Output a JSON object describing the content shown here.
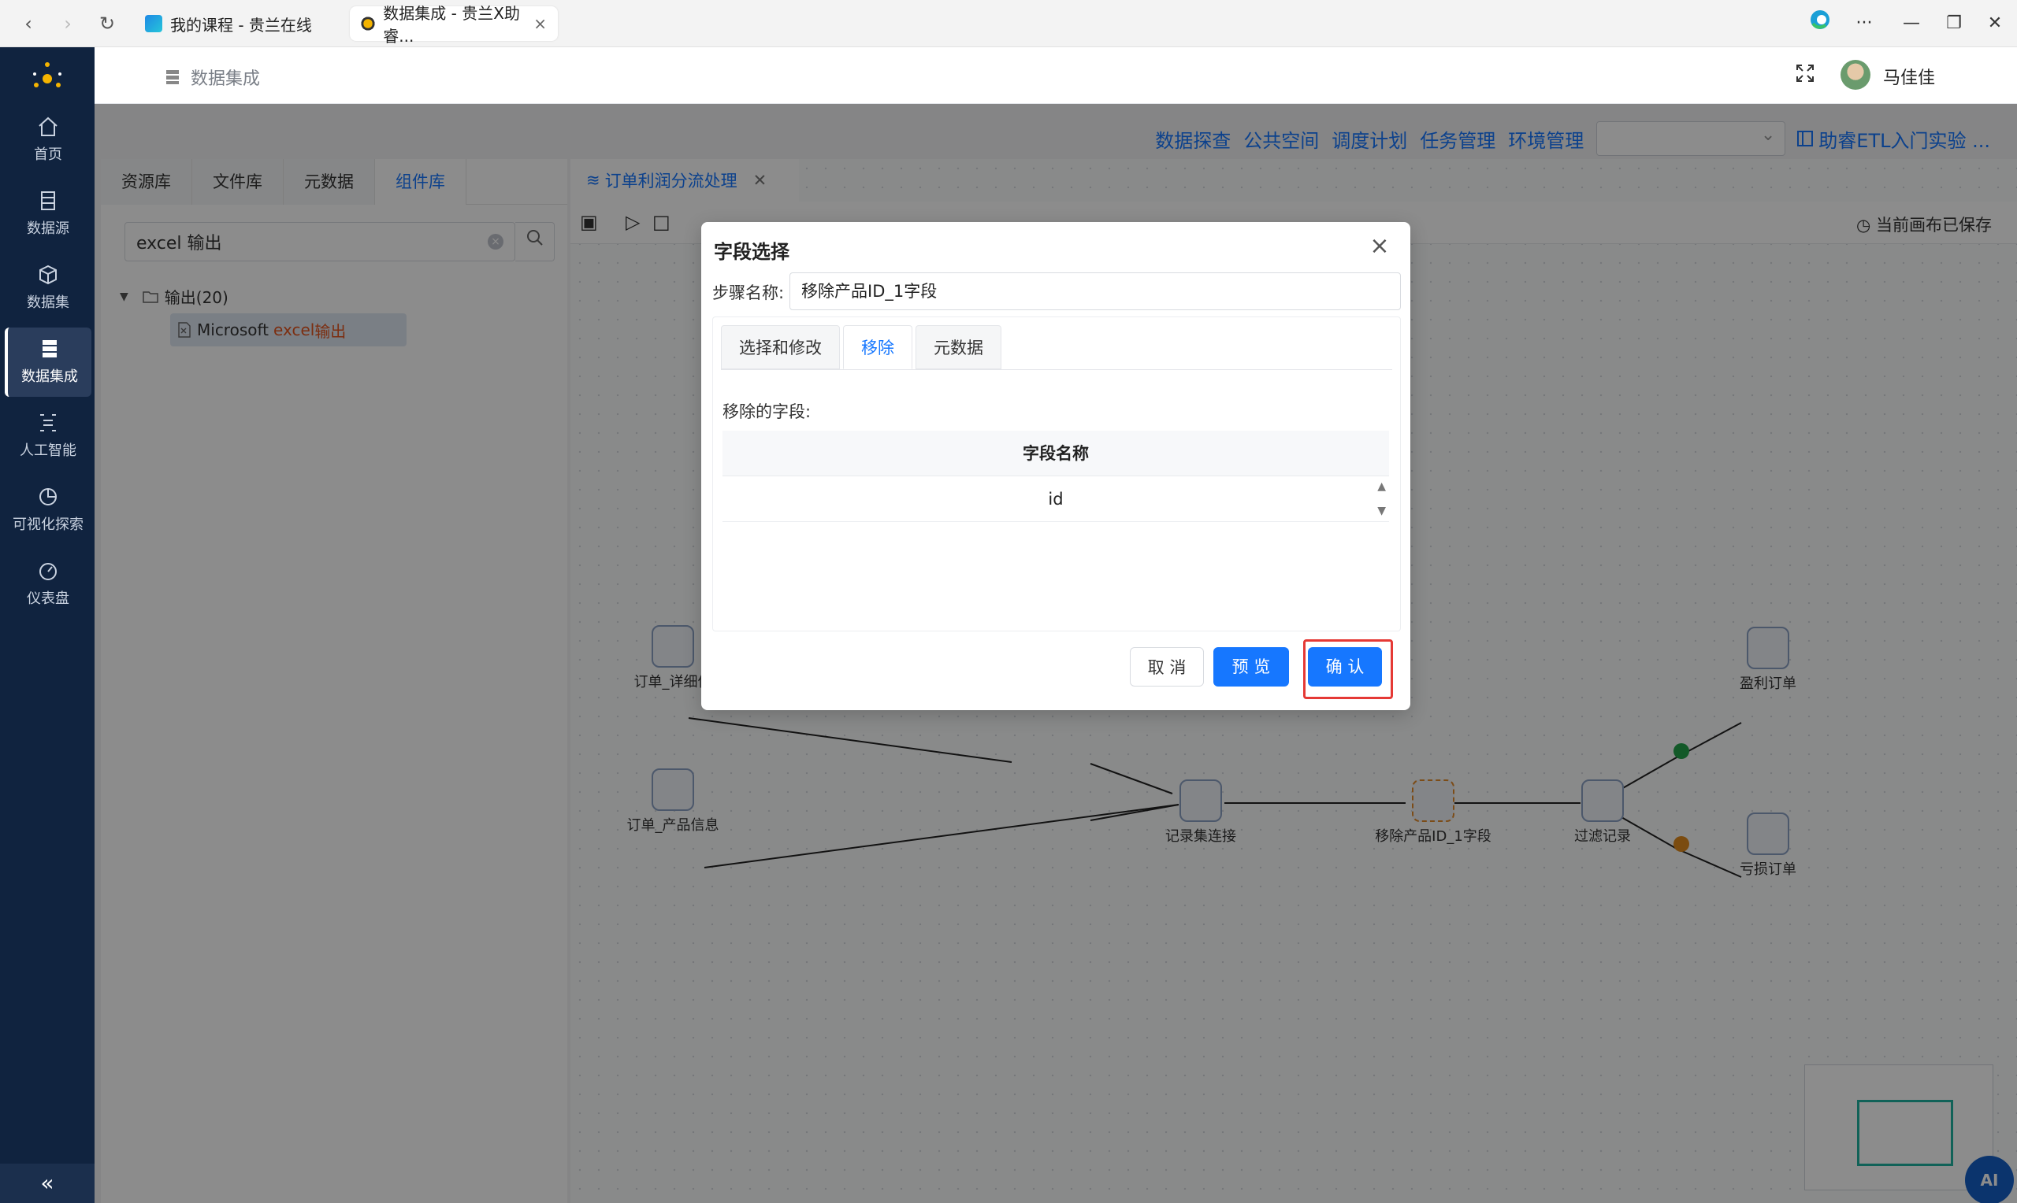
{
  "browser": {
    "tabs": [
      {
        "title": "我的课程 - 贵兰在线"
      },
      {
        "title": "数据集成 - 贵兰X助睿...",
        "close": "×"
      }
    ],
    "menu": "···"
  },
  "sidebar": {
    "items": [
      {
        "label": "首页",
        "icon": "home-icon"
      },
      {
        "label": "数据源",
        "icon": "database-icon"
      },
      {
        "label": "数据集",
        "icon": "cube-icon"
      },
      {
        "label": "数据集成",
        "icon": "server-icon"
      },
      {
        "label": "人工智能",
        "icon": "ai-icon"
      },
      {
        "label": "可视化探索",
        "icon": "pie-chart-icon"
      },
      {
        "label": "仪表盘",
        "icon": "gauge-icon"
      }
    ],
    "active_index": 3,
    "collapse": "«"
  },
  "header": {
    "breadcrumb": "数据集成",
    "user_name": "马佳佳"
  },
  "top_links": [
    "数据探查",
    "公共空间",
    "调度计划",
    "任务管理",
    "环境管理"
  ],
  "project_link": "助睿ETL入门实验 ...",
  "left_panel": {
    "tabs": [
      "资源库",
      "文件库",
      "元数据",
      "组件库"
    ],
    "active_tab": 3,
    "search_value": "excel 输出",
    "tree_group": "输出(20)",
    "tree_leaf_prefix": "Microsoft ",
    "tree_leaf_hl": "excel",
    "tree_leaf_suffix": " 输出"
  },
  "canvas": {
    "tab_title": "订单利润分流处理",
    "saved_status": "当前画布已保存",
    "nodes": [
      {
        "label": "订单_详细信"
      },
      {
        "label": "订单_产品信息"
      },
      {
        "label": "记录集连接"
      },
      {
        "label": "移除产品ID_1字段"
      },
      {
        "label": "过滤记录"
      },
      {
        "label": "盈利订单"
      },
      {
        "label": "亏损订单"
      }
    ],
    "ai_button": "AI"
  },
  "modal": {
    "title": "字段选择",
    "step_label": "步骤名称:",
    "step_value": "移除产品ID_1字段",
    "tabs": [
      "选择和修改",
      "移除",
      "元数据"
    ],
    "active_tab": 1,
    "removed_label": "移除的字段:",
    "table_header": "字段名称",
    "rows": [
      "id"
    ],
    "cancel": "取 消",
    "preview": "预 览",
    "confirm": "确 认"
  }
}
